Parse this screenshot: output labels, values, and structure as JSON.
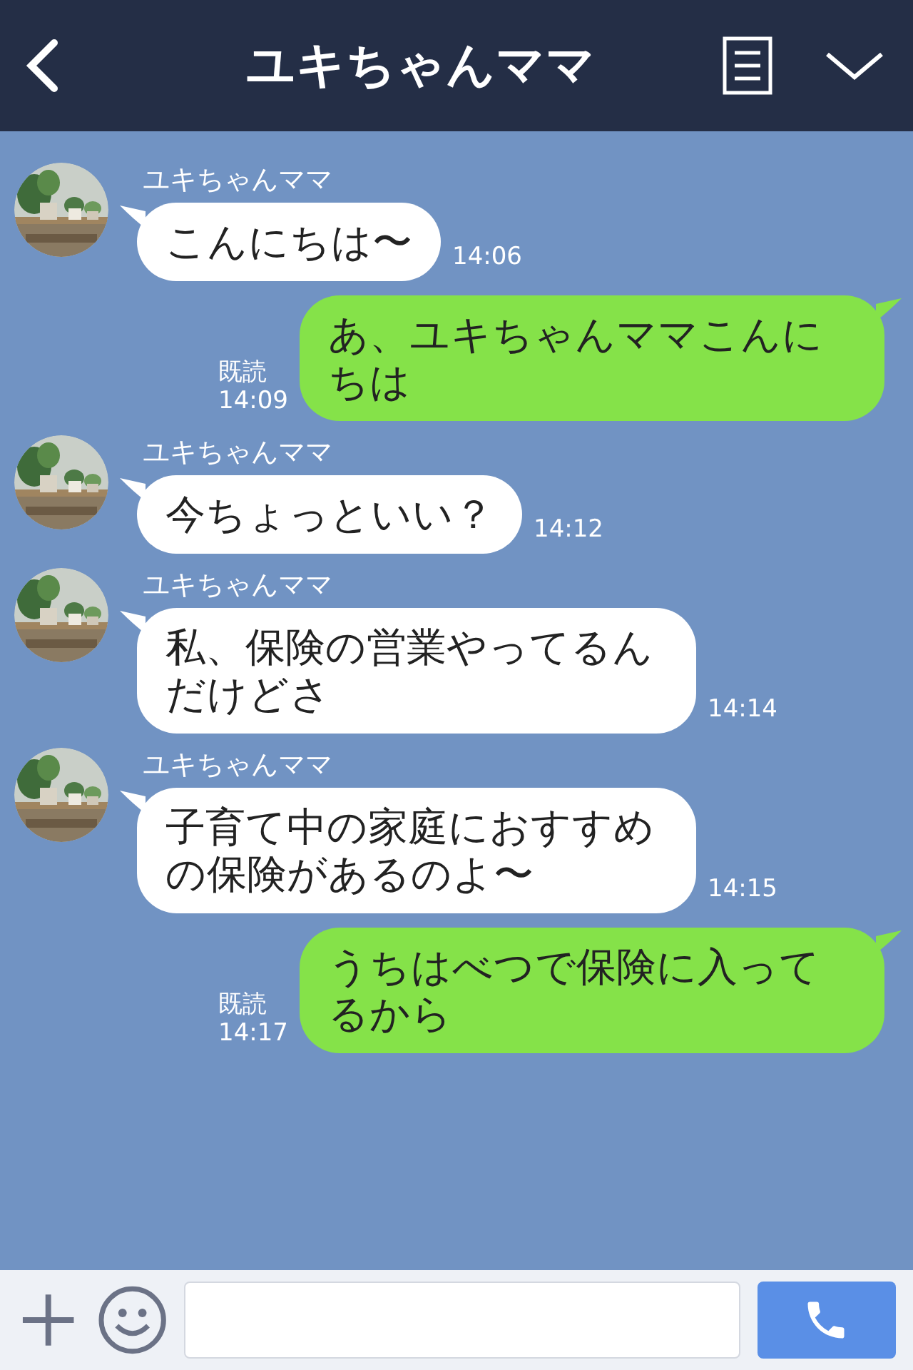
{
  "header": {
    "title": "ユキちゃんママ"
  },
  "messages": [
    {
      "kind": "received",
      "name": "ユキちゃんママ",
      "text": "こんにちは〜",
      "time": "14:06"
    },
    {
      "kind": "sent",
      "read": "既読",
      "text": "あ、ユキちゃんママこんにちは",
      "time": "14:09"
    },
    {
      "kind": "received",
      "name": "ユキちゃんママ",
      "text": "今ちょっといい？",
      "time": "14:12"
    },
    {
      "kind": "received",
      "name": "ユキちゃんママ",
      "text": "私、保険の営業やってるんだけどさ",
      "time": "14:14"
    },
    {
      "kind": "received",
      "name": "ユキちゃんママ",
      "text": "子育て中の家庭におすすめの保険があるのよ〜",
      "time": "14:15"
    },
    {
      "kind": "sent",
      "read": "既読",
      "text": "うちはべつで保険に入ってるから",
      "time": "14:17"
    }
  ]
}
